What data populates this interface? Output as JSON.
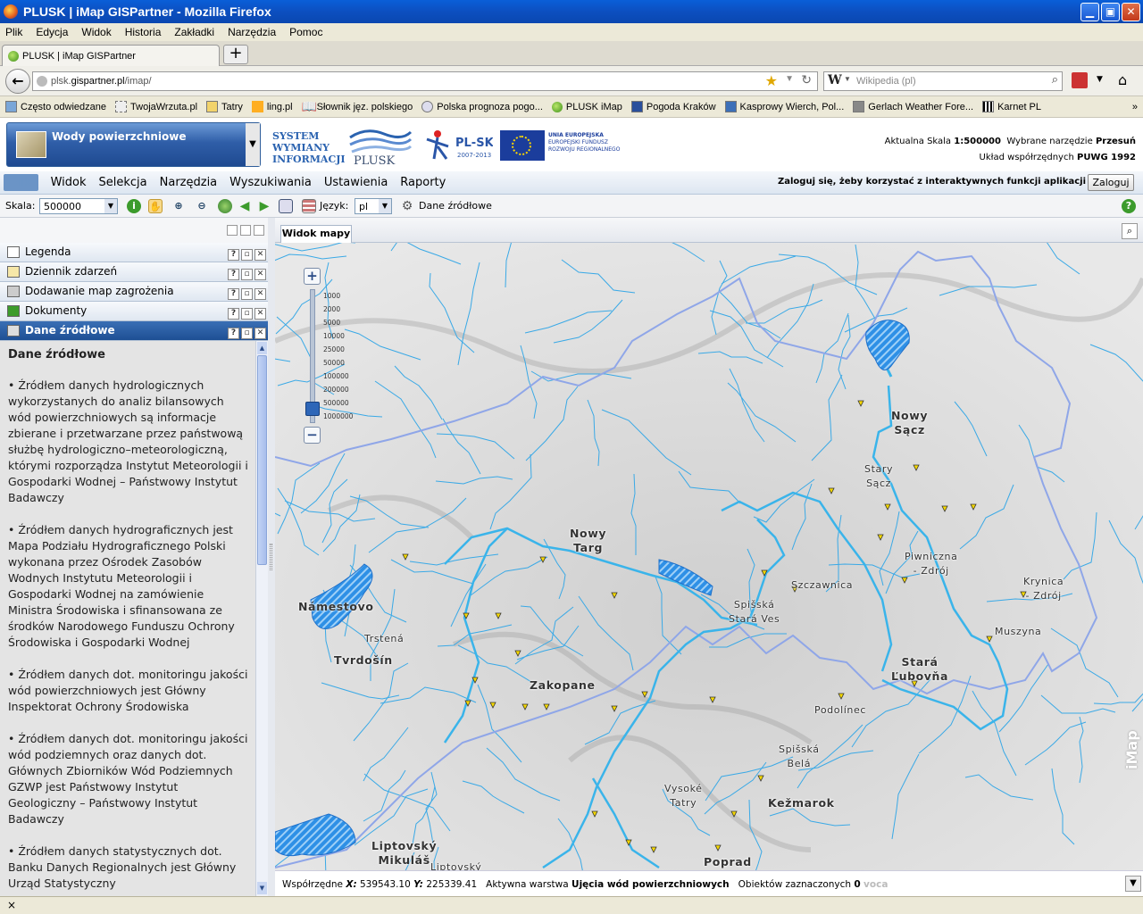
{
  "window": {
    "title": "PLUSK | iMap GISPartner - Mozilla Firefox",
    "min": "▁",
    "max": "▣",
    "close": "✕"
  },
  "menu": [
    "Plik",
    "Edycja",
    "Widok",
    "Historia",
    "Zakładki",
    "Narzędzia",
    "Pomoc"
  ],
  "tab": {
    "label": "PLUSK | iMap GISPartner",
    "new": "+"
  },
  "address": {
    "host": "plsk.gispartner.pl",
    "prefix": "plsk.",
    "domain": "gispartner.pl",
    "path": "/imap/"
  },
  "search": {
    "placeholder": "Wikipedia (pl)",
    "engine": "W"
  },
  "bookmarks": [
    "Często odwiedzane",
    "TwojaWrzuta.pl",
    "Tatry",
    "ling.pl",
    "Słownik jęz. polskiego",
    "Polska prognoza pogo...",
    "PLUSK iMap",
    "Pogoda Kraków",
    "Kasprowy Wierch, Pol...",
    "Gerlach Weather Fore...",
    "Karnet PL"
  ],
  "header": {
    "layer": "Wody powierzchniowe",
    "system": [
      "SYSTEM",
      "WYMIANY",
      "INFORMACJI"
    ],
    "plusk": "PLUSK",
    "plsk": "PL-SK",
    "plsk_years": "2007-2013",
    "eu": [
      "UNIA EUROPEJSKA",
      "EUROPEJSKI FUNDUSZ",
      "ROZWOJU REGIONALNEGO"
    ],
    "scale_label": "Aktualna Skala",
    "scale_value": "1:500000",
    "tool_label": "Wybrane narzędzie",
    "tool_value": "Przesuń",
    "coord_label": "Układ współrzędnych",
    "coord_value": "PUWG 1992"
  },
  "appmenu": {
    "items": [
      "Plik",
      "Widok",
      "Selekcja",
      "Narzędzia",
      "Wyszukiwania",
      "Ustawienia",
      "Raporty"
    ],
    "login_msg": "Zaloguj się, żeby korzystać z interaktywnych funkcji aplikacji",
    "login_btn": "Zaloguj"
  },
  "toolbar": {
    "scale_label": "Skala:",
    "scale_value": "500000",
    "lang_label": "Język:",
    "lang_value": "pl",
    "source": "Dane źródłowe"
  },
  "panels": [
    "Legenda",
    "Dziennik zdarzeń",
    "Dodawanie map zagrożenia",
    "Dokumenty",
    "Dane źródłowe"
  ],
  "content": {
    "title": "Dane źródłowe",
    "paras": [
      "• Źródłem danych hydrologicznych wykorzystanych do analiz bilansowych wód powierzchniowych są informacje zbierane i przetwarzane przez państwową służbę hydrologiczno–meteorologiczną, którymi rozporządza Instytut Meteorologii i Gospodarki Wodnej – Państwowy Instytut Badawczy",
      "• Źródłem danych hydrograficznych jest Mapa Podziału Hydrograficznego Polski wykonana przez Ośrodek Zasobów Wodnych Instytutu Meteorologii i Gospodarki Wodnej na zamówienie Ministra Środowiska i sfinansowana ze środków Narodowego Funduszu Ochrony Środowiska i Gospodarki Wodnej",
      "• Źródłem danych dot. monitoringu jakości wód powierzchniowych jest Główny Inspektorat Ochrony Środowiska",
      "• Źródłem danych dot. monitoringu jakości wód podziemnych oraz danych dot. Głównych Zbiorników Wód Podziemnych GZWP jest Państwowy Instytut Geologiczny – Państwowy Instytut Badawczy",
      "• Źródłem danych statystycznych dot. Banku Danych Regionalnych jest Główny Urząd Statystyczny"
    ]
  },
  "map": {
    "tab": "Widok mapy",
    "zoom_levels": [
      "1000",
      "2000",
      "5000",
      "10000",
      "25000",
      "50000",
      "100000",
      "200000",
      "500000",
      "1000000"
    ],
    "cities": [
      {
        "id": "nowy-sacz",
        "name": "Nowy\nSącz"
      },
      {
        "id": "stary-sacz",
        "name": "Stary\nSącz"
      },
      {
        "id": "nowy-targ",
        "name": "Nowy\nTarg"
      },
      {
        "id": "piwniczna",
        "name": "Piwniczna\n- Zdrój"
      },
      {
        "id": "krynica",
        "name": "Krynica\n- Zdrój"
      },
      {
        "id": "szczawnica",
        "name": "Szczawnica"
      },
      {
        "id": "spisska-stara-ves",
        "name": "Spišská\nStará Ves"
      },
      {
        "id": "namestovo",
        "name": "Námestovo"
      },
      {
        "id": "trstena",
        "name": "Trstená"
      },
      {
        "id": "tvrdosin",
        "name": "Tvrdošín"
      },
      {
        "id": "muszyna",
        "name": "Muszyna"
      },
      {
        "id": "stara-lubovna",
        "name": "Stará\nĽubovňa"
      },
      {
        "id": "zakopane",
        "name": "Zakopane"
      },
      {
        "id": "podolinec",
        "name": "Podolínec"
      },
      {
        "id": "spisska-bela",
        "name": "Spišská\nBelá"
      },
      {
        "id": "vysoke-tatry",
        "name": "Vysoké\nTatry"
      },
      {
        "id": "kezmarok",
        "name": "Kežmarok"
      },
      {
        "id": "liptovsky-mikulas",
        "name": "Liptovský\nMikuláš"
      },
      {
        "id": "liptovsky",
        "name": "Liptovský"
      },
      {
        "id": "poprad",
        "name": "Poprad"
      }
    ],
    "watermark": "iMap"
  },
  "status": {
    "coord_label": "Współrzędne",
    "x_label": "X:",
    "x": "539543.10",
    "y_label": "Y:",
    "y": "225339.41",
    "layer_label": "Aktywna warstwa",
    "layer": "Ujęcia wód powierzchniowych",
    "sel_label": "Obiektów zaznaczonych",
    "sel": "0",
    "trailing": "voca"
  },
  "ffstatus": "×",
  "colors": {
    "river": "#3aa9e6",
    "border": "#8fa6e8",
    "lake": "#2e90e6",
    "accent": "#1e4f94"
  }
}
